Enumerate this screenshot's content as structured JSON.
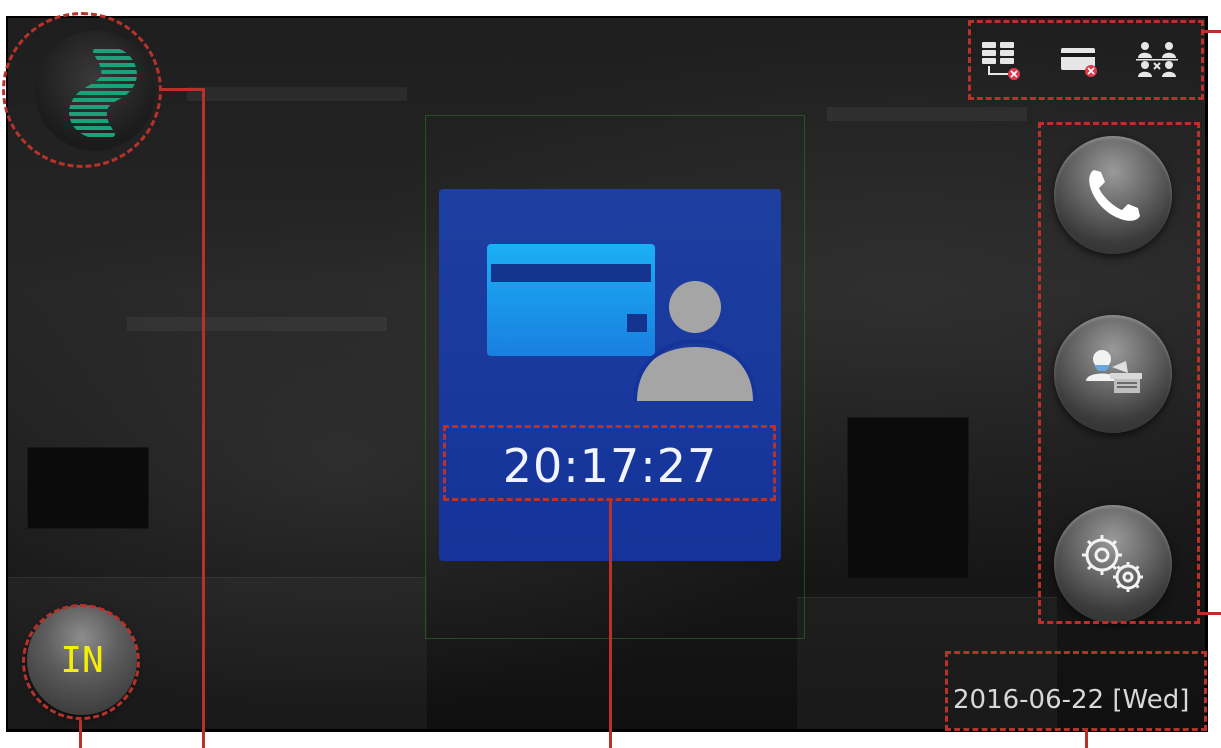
{
  "clock": {
    "time": "20:17:27"
  },
  "date": {
    "text": "2016-06-22 [Wed]"
  },
  "attendance": {
    "state_label": "IN"
  },
  "status_icons": [
    {
      "name": "server-disconnected-icon"
    },
    {
      "name": "card-reader-error-icon"
    },
    {
      "name": "users-sync-icon"
    }
  ],
  "side_buttons": [
    {
      "name": "call-button",
      "icon": "phone-icon"
    },
    {
      "name": "user-verify-button",
      "icon": "user-desk-icon"
    },
    {
      "name": "settings-button",
      "icon": "gears-icon"
    }
  ],
  "colors": {
    "card_bg": "#15339a",
    "card_icon_blue": "#1ea0f0",
    "in_label": "#f5f000",
    "annotation": "#b8322a",
    "logo_green": "#1aa37a"
  }
}
